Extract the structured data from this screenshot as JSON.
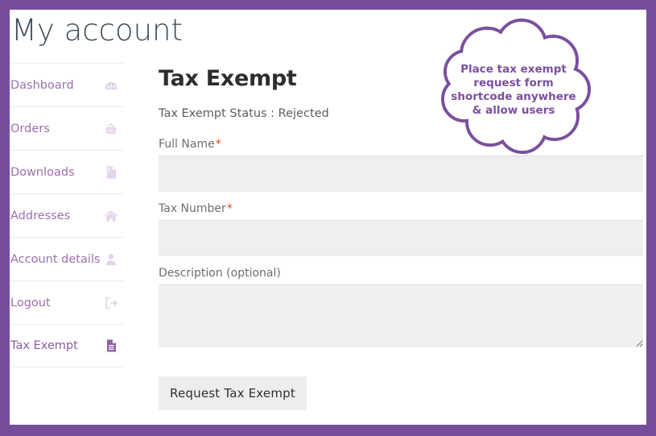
{
  "page": {
    "title": "My account",
    "accent_color": "#754d9b",
    "frame_border_color": "#754d9b"
  },
  "sidebar": {
    "items": [
      {
        "label": "Dashboard",
        "icon": "gauge-icon",
        "active": false
      },
      {
        "label": "Orders",
        "icon": "basket-icon",
        "active": false
      },
      {
        "label": "Downloads",
        "icon": "download-file-icon",
        "active": false
      },
      {
        "label": "Addresses",
        "icon": "home-icon",
        "active": false
      },
      {
        "label": "Account details",
        "icon": "user-icon",
        "active": false
      },
      {
        "label": "Logout",
        "icon": "logout-icon",
        "active": false
      },
      {
        "label": "Tax Exempt",
        "icon": "document-icon",
        "active": true
      }
    ]
  },
  "main": {
    "heading": "Tax Exempt",
    "status_label": "Tax Exempt Status : Rejected",
    "fields": [
      {
        "label": "Full Name",
        "required": true,
        "required_mark": "*",
        "value": "",
        "placeholder": "",
        "type": "text"
      },
      {
        "label": "Tax Number",
        "required": true,
        "required_mark": "*",
        "value": "",
        "placeholder": "",
        "type": "text"
      },
      {
        "label": "Description (optional)",
        "required": false,
        "required_mark": "",
        "value": "",
        "placeholder": "",
        "type": "textarea"
      }
    ],
    "submit_label": "Request Tax Exempt"
  },
  "callout": {
    "lines": [
      "Place tax exempt",
      "request form",
      "shortcode anywhere",
      "& allow users"
    ],
    "color": "#7b4f9e"
  }
}
